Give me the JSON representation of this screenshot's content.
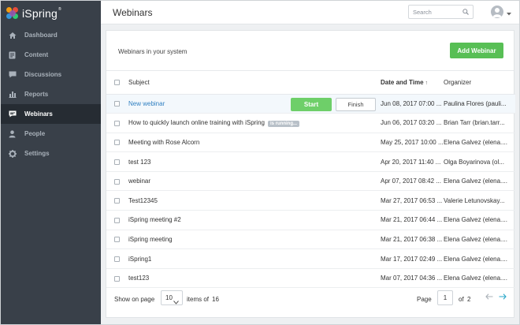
{
  "brand": {
    "name": "iSpring",
    "mark": "®"
  },
  "sidebar": {
    "items": [
      {
        "label": "Dashboard",
        "icon": "home-icon",
        "active": false
      },
      {
        "label": "Content",
        "icon": "content-icon",
        "active": false
      },
      {
        "label": "Discussions",
        "icon": "chat-icon",
        "active": false
      },
      {
        "label": "Reports",
        "icon": "reports-icon",
        "active": false
      },
      {
        "label": "Webinars",
        "icon": "webinar-icon",
        "active": true
      },
      {
        "label": "People",
        "icon": "person-icon",
        "active": false
      },
      {
        "label": "Settings",
        "icon": "gear-icon",
        "active": false
      }
    ]
  },
  "header": {
    "title": "Webinars",
    "search_placeholder": "Search"
  },
  "panel": {
    "subtitle": "Webinars in your system",
    "add_label": "Add Webinar",
    "columns": {
      "subject": "Subject",
      "date": "Date and Time",
      "organizer": "Organizer"
    },
    "rows": [
      {
        "subject": "New webinar",
        "date": "Jun 08, 2017 07:00 ...",
        "organizer": "Paulina Flores (pauli..."
      },
      {
        "subject": "How to quickly launch online training with iSpring",
        "badge": "is running...",
        "date": "Jun 06, 2017 03:20 ...",
        "organizer": "Brian Tarr (brian.tarr..."
      },
      {
        "subject": "Meeting with Rose Alcorn",
        "date": "May 25, 2017 10:00 ...",
        "organizer": "Elena Galvez (elena...."
      },
      {
        "subject": "test 123",
        "date": "Apr 20, 2017 11:40 ...",
        "organizer": "Olga Boyarinova (ol..."
      },
      {
        "subject": "webinar",
        "date": "Apr 07, 2017 08:42 ...",
        "organizer": "Elena Galvez (elena...."
      },
      {
        "subject": "Test12345",
        "date": "Mar 27, 2017 06:53 ...",
        "organizer": "Valerie Letunovskay..."
      },
      {
        "subject": "iSpring meeting #2",
        "date": "Mar 21, 2017 06:44 ...",
        "organizer": "Elena Galvez (elena...."
      },
      {
        "subject": "iSpring meeting",
        "date": "Mar 21, 2017 06:38 ...",
        "organizer": "Elena Galvez (elena...."
      },
      {
        "subject": "iSpring1",
        "date": "Mar 17, 2017 02:49 ...",
        "organizer": "Elena Galvez (elena...."
      },
      {
        "subject": "test123",
        "date": "Mar 07, 2017 04:36 ...",
        "organizer": "Elena Galvez (elena...."
      }
    ],
    "start_label": "Start",
    "finish_label": "Finish"
  },
  "footer": {
    "show_on_page": "Show on page",
    "page_size": "10",
    "items_of": "items of",
    "total": "16",
    "page_label": "Page",
    "current_page": "1",
    "of": "of",
    "page_count": "2"
  },
  "colors": {
    "sidebar": "#394049",
    "active": "#262c33",
    "accent_green": "#58bf55",
    "link_blue": "#2f7fc1"
  }
}
